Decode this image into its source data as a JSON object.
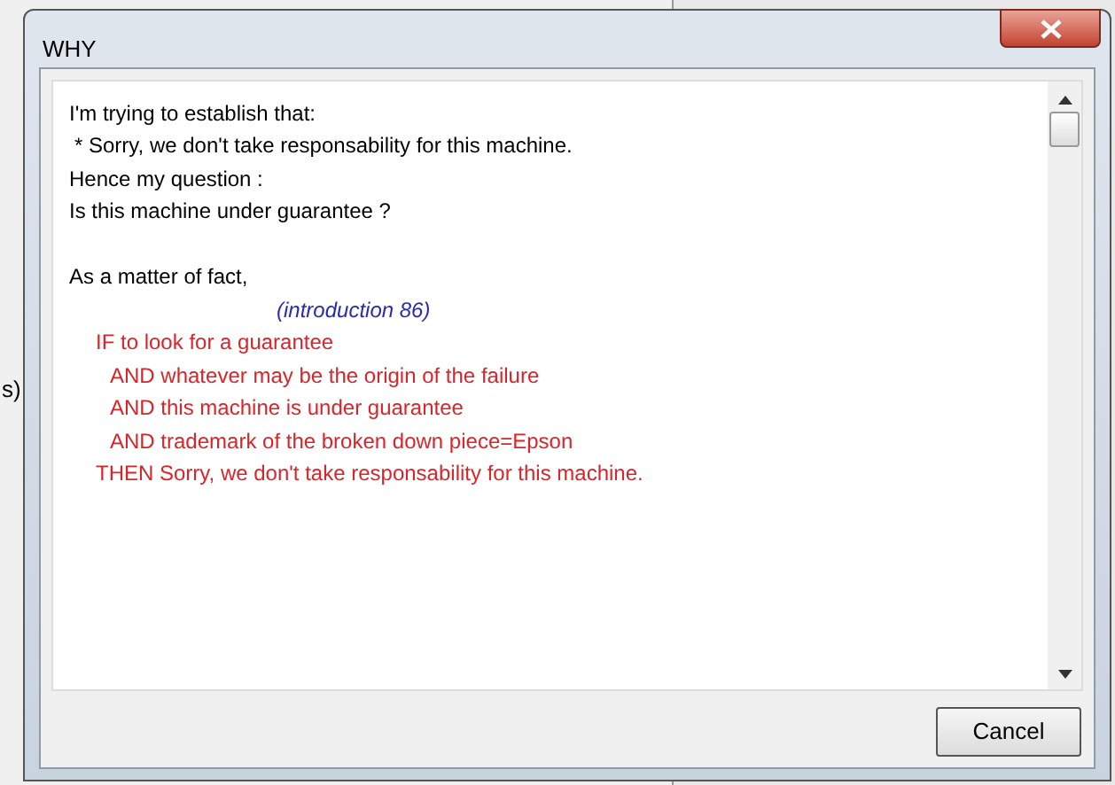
{
  "background": {
    "text": "s)"
  },
  "dialog": {
    "title": "WHY",
    "lines": [
      {
        "kind": "text",
        "text": "I'm trying to establish that:"
      },
      {
        "kind": "bullet",
        "text": "* Sorry, we don't take responsability for this machine."
      },
      {
        "kind": "text",
        "text": "Hence my question :"
      },
      {
        "kind": "text",
        "text": "Is this machine under guarantee ?"
      },
      {
        "kind": "paragraph",
        "text": "As a matter of fact,"
      },
      {
        "kind": "reference",
        "text": "(introduction 86)"
      },
      {
        "kind": "rule-head",
        "text": "IF to look for a guarantee"
      },
      {
        "kind": "rule-cond",
        "text": "AND whatever may be the origin of the failure"
      },
      {
        "kind": "rule-cond",
        "text": "AND this machine is under guarantee"
      },
      {
        "kind": "rule-cond",
        "text": "AND trademark of the broken down piece=Epson"
      },
      {
        "kind": "rule-head",
        "text": "THEN Sorry, we don't take responsability for this machine."
      }
    ],
    "buttons": [
      "Cancel"
    ]
  }
}
